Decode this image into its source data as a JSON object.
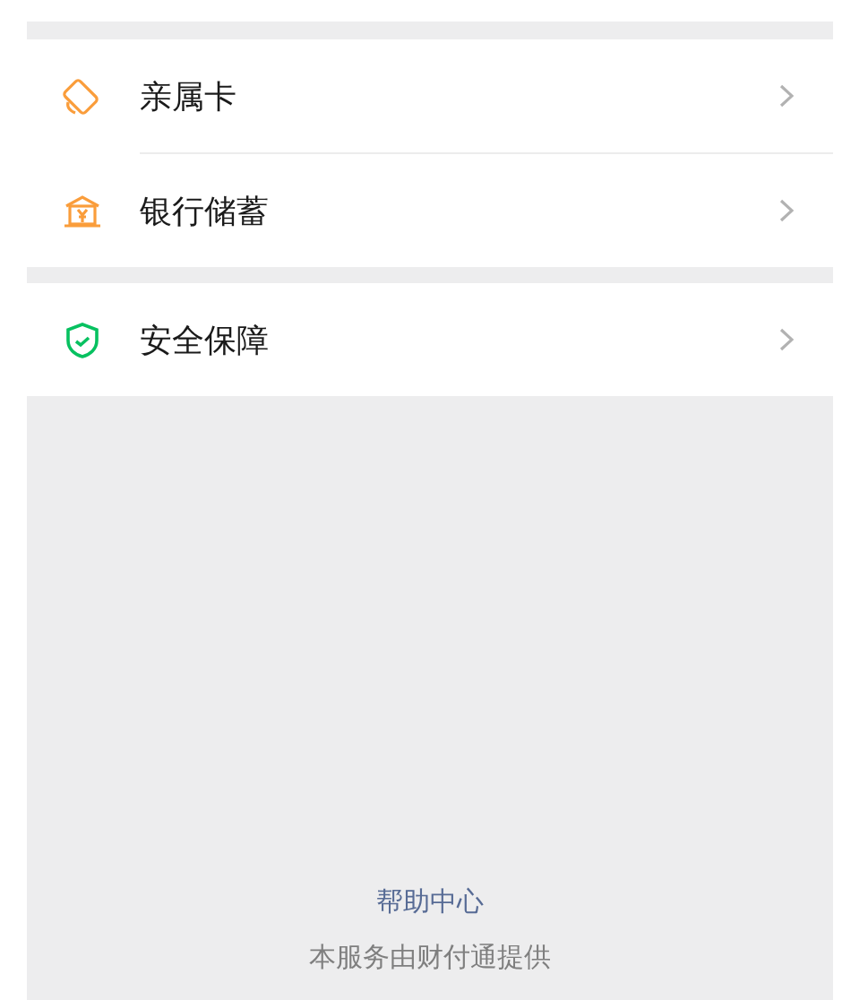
{
  "sections": [
    {
      "items": [
        {
          "kind": "card",
          "label": "亲属卡"
        },
        {
          "kind": "bank",
          "label": "银行储蓄"
        }
      ]
    },
    {
      "items": [
        {
          "kind": "shield",
          "label": "安全保障"
        }
      ]
    }
  ],
  "footer": {
    "link": "帮助中心",
    "note": "本服务由财付通提供"
  }
}
